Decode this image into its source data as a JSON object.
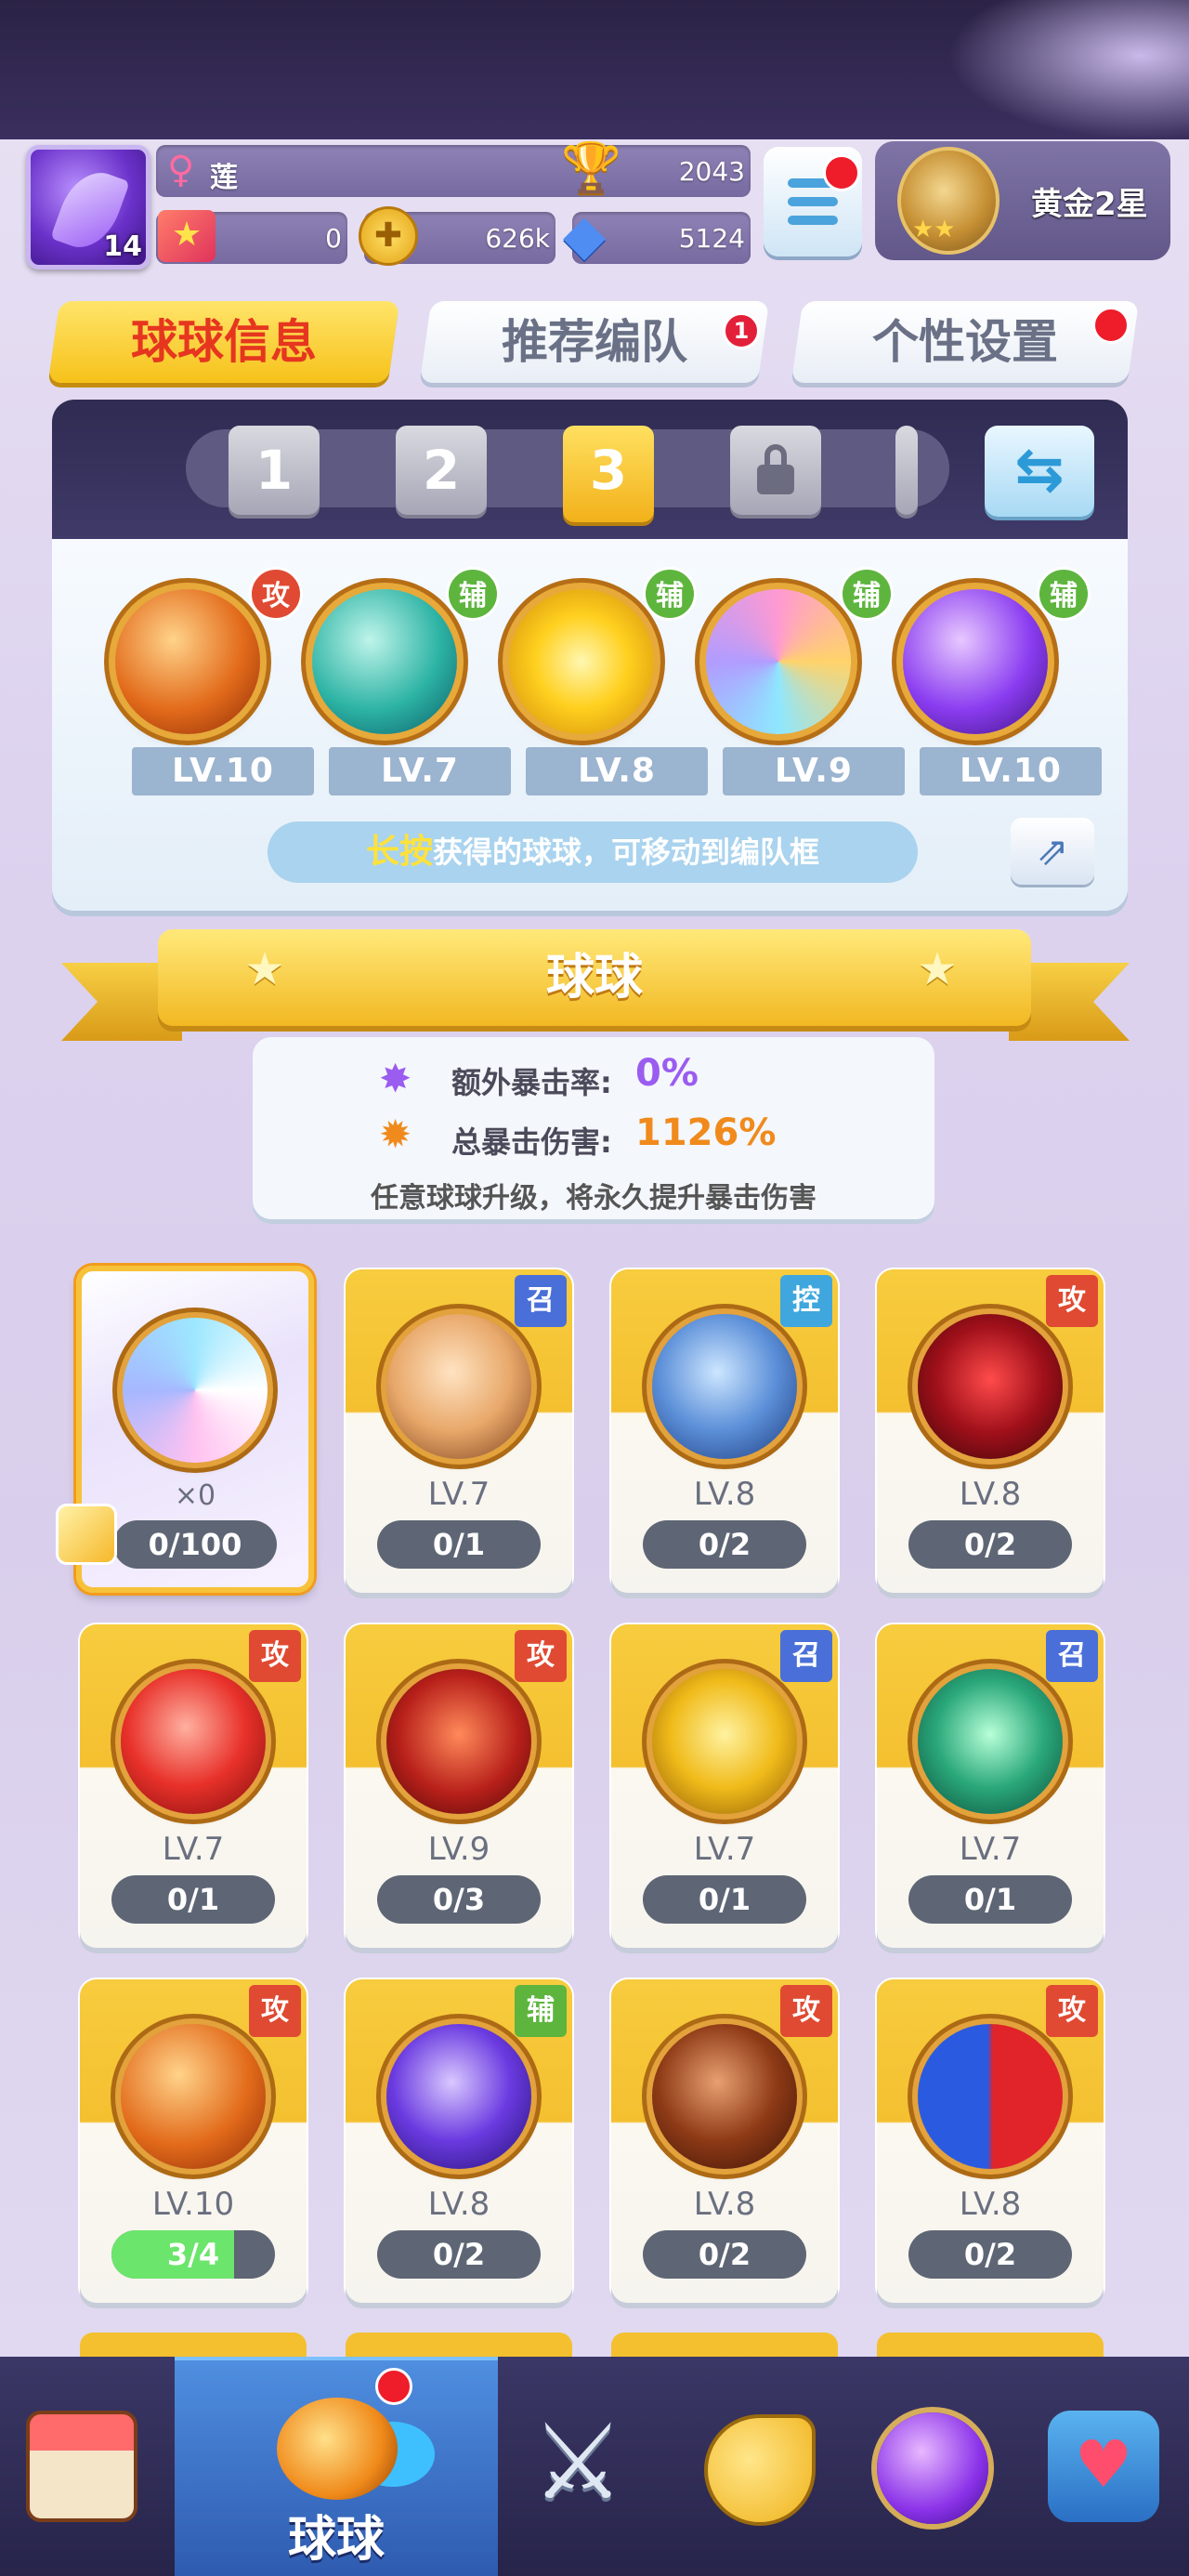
{
  "header": {
    "player_level": "14",
    "gender_icon": "female-icon",
    "player_name": "莲",
    "trophies": "2043",
    "tickets": "0",
    "coins": "626k",
    "gems": "5124",
    "rank": "黄金2星"
  },
  "tabs": [
    {
      "label": "球球信息",
      "active": true,
      "badge": ""
    },
    {
      "label": "推荐编队",
      "active": false,
      "badge": "1"
    },
    {
      "label": "个性设置",
      "active": false,
      "badge": ""
    }
  ],
  "team": {
    "slots": [
      "1",
      "2",
      "3"
    ],
    "selected_slot": "3",
    "balls": [
      {
        "tag": "攻",
        "level": "LV.10",
        "icon": "phoenix-orb-icon"
      },
      {
        "tag": "辅",
        "level": "LV.7",
        "icon": "dragon-orb-icon"
      },
      {
        "tag": "辅",
        "level": "LV.8",
        "icon": "sun-orb-icon"
      },
      {
        "tag": "辅",
        "level": "LV.9",
        "icon": "silhouettes-orb-icon"
      },
      {
        "tag": "辅",
        "level": "LV.10",
        "icon": "purple-leaf-orb-icon"
      }
    ],
    "hint_highlight": "长按",
    "hint_rest": "获得的球球，可移动到编队框"
  },
  "section_title": "球球",
  "crit": {
    "extra_label": "额外暴击率:",
    "extra_value": "0%",
    "total_label": "总暴击伤害:",
    "total_value": "1126%",
    "note": "任意球球升级，将永久提升暴击伤害"
  },
  "cards": [
    {
      "special": true,
      "tag": "",
      "count": "×0",
      "progress": "0/100",
      "fill": 0,
      "icon": "mystery-orb-icon"
    },
    {
      "tag": "召",
      "level": "LV.7",
      "progress": "0/1",
      "fill": 0,
      "icon": "blonde-hero-orb-icon"
    },
    {
      "tag": "控",
      "level": "LV.8",
      "progress": "0/2",
      "fill": 0,
      "icon": "warrior-orb-icon"
    },
    {
      "tag": "攻",
      "level": "LV.8",
      "progress": "0/2",
      "fill": 0,
      "icon": "venom-orb-icon"
    },
    {
      "tag": "攻",
      "level": "LV.7",
      "progress": "0/1",
      "fill": 0,
      "icon": "red-blob-orb-icon"
    },
    {
      "tag": "攻",
      "level": "LV.9",
      "progress": "0/3",
      "fill": 0,
      "icon": "trident-orb-icon"
    },
    {
      "tag": "召",
      "level": "LV.7",
      "progress": "0/1",
      "fill": 0,
      "icon": "golden-hand-orb-icon"
    },
    {
      "tag": "召",
      "level": "LV.7",
      "progress": "0/1",
      "fill": 0,
      "icon": "jade-swirl-orb-icon"
    },
    {
      "tag": "攻",
      "level": "LV.10",
      "progress": "3/4",
      "fill": 0.75,
      "icon": "phoenix-orb-icon"
    },
    {
      "tag": "辅",
      "level": "LV.8",
      "progress": "0/2",
      "fill": 0,
      "icon": "lightning-orb-icon"
    },
    {
      "tag": "攻",
      "level": "LV.8",
      "progress": "0/2",
      "fill": 0,
      "icon": "infinity-orb-icon"
    },
    {
      "tag": "攻",
      "level": "LV.8",
      "progress": "0/2",
      "fill": 0,
      "icon": "opera-mask-orb-icon"
    }
  ],
  "bottom_nav": [
    {
      "icon": "shop-icon",
      "label": ""
    },
    {
      "icon": "balls-icon",
      "label": "球球",
      "active": true
    },
    {
      "icon": "crossed-swords-icon",
      "label": ""
    },
    {
      "icon": "whistle-icon",
      "label": ""
    },
    {
      "icon": "planet-icon",
      "label": ""
    },
    {
      "icon": "chat-heart-icon",
      "label": ""
    }
  ],
  "colors": {
    "accent_yellow": "#f6c21a",
    "attack_red": "#e04a32",
    "support_green": "#5db53e",
    "summon_blue": "#4b6fd8",
    "control_sky": "#3fa7dd",
    "crit_purple": "#9b5cf0",
    "crit_orange": "#f08a1c"
  }
}
